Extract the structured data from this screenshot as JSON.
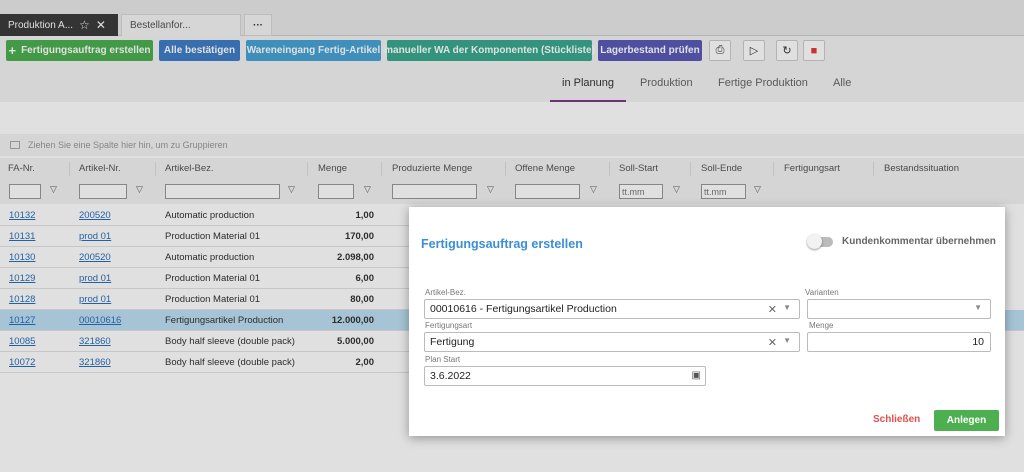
{
  "tabs": [
    {
      "label": "Produktion A..."
    },
    {
      "label": "Bestellanfor..."
    },
    {
      "label": "···"
    }
  ],
  "toolbar": {
    "create_order": "Fertigungsauftrag erstellen",
    "confirm_all": "Alle bestätigen",
    "goods_receipt": "Wareneingang Fertig-Artikel",
    "manual_issue": "manueller WA der Komponenten (Stückliste)",
    "check_stock": "Lagerbestand prüfen"
  },
  "status_tabs": [
    "in Planung",
    "Produktion",
    "Fertige Produktion",
    "Alle"
  ],
  "group_hint": "Ziehen Sie eine Spalte hier hin, um zu Gruppieren",
  "columns": [
    "FA-Nr.",
    "Artikel-Nr.",
    "Artikel-Bez.",
    "Menge",
    "Produzierte Menge",
    "Offene Menge",
    "Soll-Start",
    "Soll-Ende",
    "Fertigungsart",
    "Bestandssituation"
  ],
  "filter_date_placeholder": "tt.mm",
  "rows": [
    {
      "fa": "10132",
      "art": "200520",
      "bez": "Automatic production",
      "menge": "1,00"
    },
    {
      "fa": "10131",
      "art": "prod 01",
      "bez": "Production Material 01",
      "menge": "170,00"
    },
    {
      "fa": "10130",
      "art": "200520",
      "bez": "Automatic production",
      "menge": "2.098,00"
    },
    {
      "fa": "10129",
      "art": "prod 01",
      "bez": "Production Material 01",
      "menge": "6,00"
    },
    {
      "fa": "10128",
      "art": "prod 01",
      "bez": "Production Material 01",
      "menge": "80,00"
    },
    {
      "fa": "10127",
      "art": "00010616",
      "bez": "Fertigungsartikel Production",
      "menge": "12.000,00"
    },
    {
      "fa": "10085",
      "art": "321860",
      "bez": "Body half sleeve (double pack)",
      "menge": "5.000,00"
    },
    {
      "fa": "10072",
      "art": "321860",
      "bez": "Body half sleeve (double pack)",
      "menge": "2,00"
    }
  ],
  "modal": {
    "title": "Fertigungsauftrag erstellen",
    "toggle_label": "Kundenkommentar übernehmen",
    "artikel_label": "Artikel-Bez.",
    "artikel_value": "00010616 - Fertigungsartikel Production",
    "varianten_label": "Varianten",
    "varianten_value": "",
    "fertigungsart_label": "Fertigungsart",
    "fertigungsart_value": "Fertigung",
    "menge_label": "Menge",
    "menge_value": "10",
    "planstart_label": "Plan Start",
    "planstart_value": "3.6.2022",
    "close": "Schließen",
    "add": "Anlegen"
  }
}
